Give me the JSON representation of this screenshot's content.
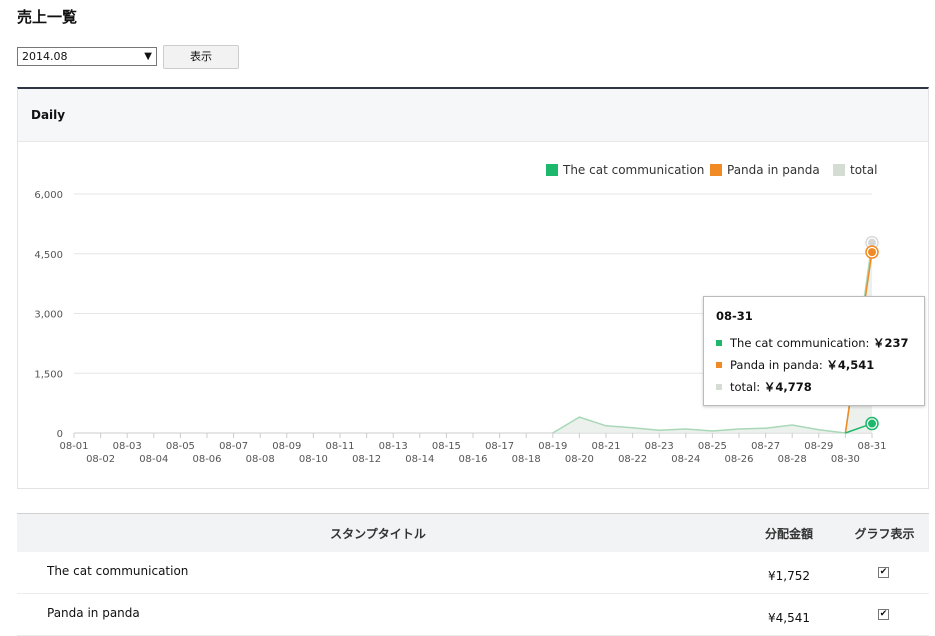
{
  "page": {
    "title": "売上一覧"
  },
  "controls": {
    "month_value": "2014.08",
    "show_button": "表示"
  },
  "card": {
    "header": "Daily"
  },
  "chart_data": {
    "type": "line",
    "categories": [
      "08-01",
      "08-02",
      "08-03",
      "08-04",
      "08-05",
      "08-06",
      "08-07",
      "08-08",
      "08-09",
      "08-10",
      "08-11",
      "08-12",
      "08-13",
      "08-14",
      "08-15",
      "08-16",
      "08-17",
      "08-18",
      "08-19",
      "08-20",
      "08-21",
      "08-22",
      "08-23",
      "08-24",
      "08-25",
      "08-26",
      "08-27",
      "08-28",
      "08-29",
      "08-30",
      "08-31"
    ],
    "ylim": [
      0,
      6000
    ],
    "yticks": [
      "0",
      "1,500",
      "3,000",
      "4,500",
      "6,000"
    ],
    "grid": true,
    "legend_position": "top-right",
    "series": [
      {
        "name": "The cat communication",
        "color": "#1db86c",
        "values": [
          0,
          0,
          0,
          0,
          0,
          0,
          0,
          0,
          0,
          0,
          0,
          0,
          0,
          0,
          0,
          0,
          0,
          0,
          0,
          0,
          0,
          0,
          0,
          0,
          0,
          0,
          0,
          0,
          0,
          0,
          237
        ]
      },
      {
        "name": "Panda in panda",
        "color": "#f08a24",
        "values": [
          0,
          0,
          0,
          0,
          0,
          0,
          0,
          0,
          0,
          0,
          0,
          0,
          0,
          0,
          0,
          0,
          0,
          0,
          0,
          0,
          0,
          0,
          0,
          0,
          0,
          0,
          0,
          0,
          0,
          0,
          4541
        ]
      },
      {
        "name": "total",
        "color": "#d4dcd4",
        "values": [
          0,
          0,
          0,
          0,
          0,
          0,
          0,
          0,
          0,
          0,
          0,
          0,
          0,
          0,
          0,
          0,
          0,
          0,
          0,
          400,
          180,
          130,
          70,
          100,
          50,
          100,
          120,
          200,
          80,
          0,
          4778
        ]
      }
    ],
    "tooltip": {
      "title": "08-31",
      "rows": [
        {
          "label": "The cat communication:",
          "value": "￥237",
          "color": "#1db86c"
        },
        {
          "label": "Panda in panda:",
          "value": "￥4,541",
          "color": "#f08a24"
        },
        {
          "label": "total:",
          "value": "￥4,778",
          "color": "#d4dcd4"
        }
      ]
    }
  },
  "table": {
    "headers": {
      "title": "スタンプタイトル",
      "amount": "分配金額",
      "graph": "グラフ表示"
    },
    "rows": [
      {
        "title": "The cat communication",
        "amount": "¥1,752",
        "checked": true
      },
      {
        "title": "Panda in panda",
        "amount": "¥4,541",
        "checked": true
      }
    ]
  }
}
